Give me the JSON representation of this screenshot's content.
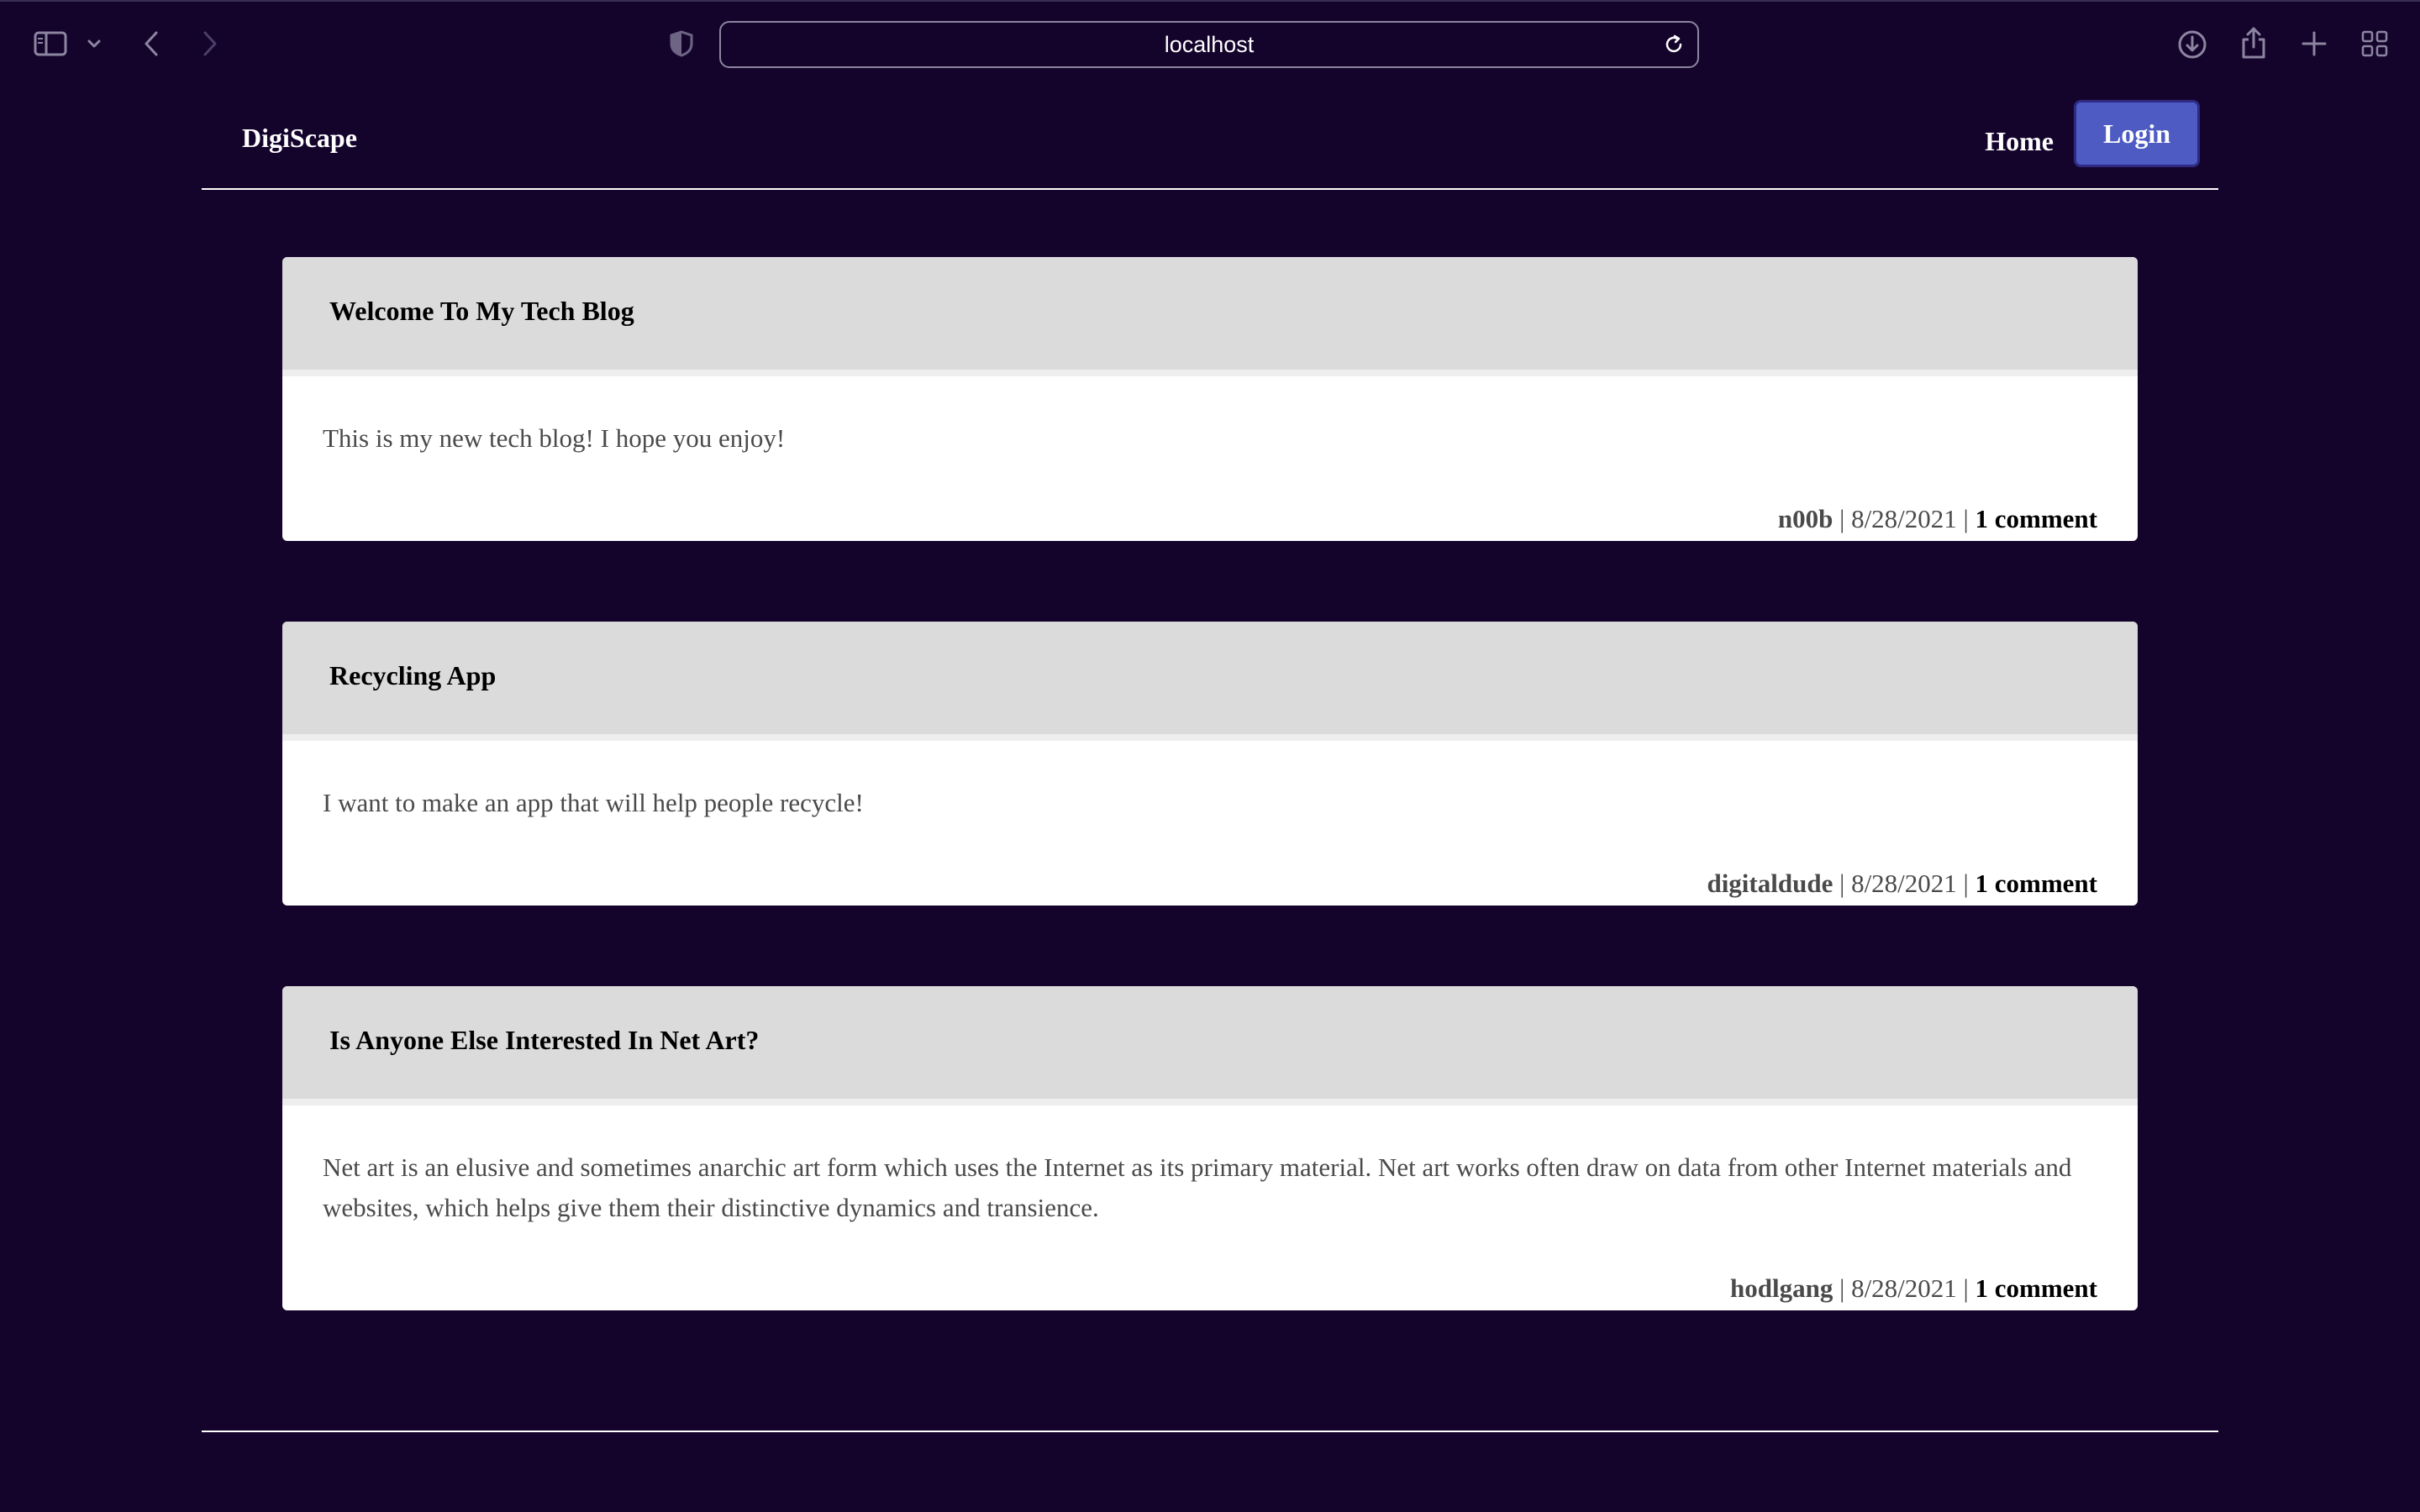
{
  "browser": {
    "url": "localhost"
  },
  "header": {
    "brand": "DigiScape",
    "nav_home": "Home",
    "nav_login": "Login"
  },
  "posts": [
    {
      "title": "Welcome To My Tech Blog",
      "body": "This is my new tech blog! I hope you enjoy!",
      "author": "n00b",
      "date": "8/28/2021",
      "comments": "1 comment"
    },
    {
      "title": "Recycling App",
      "body": "I want to make an app that will help people recycle!",
      "author": "digitaldude",
      "date": "8/28/2021",
      "comments": "1 comment"
    },
    {
      "title": "Is Anyone Else Interested In Net Art?",
      "body": "Net art is an elusive and sometimes anarchic art form which uses the Internet as its primary material. Net art works often draw on data from other Internet materials and websites, which helps give them their distinctive dynamics and transience.",
      "author": "hodlgang",
      "date": "8/28/2021",
      "comments": "1 comment"
    }
  ],
  "meta_separator": "|",
  "colors": {
    "page_background": "#14042c",
    "card_header": "#dbdbdb",
    "login_button": "#4d5bc3"
  },
  "icons": [
    "sidebar-icon",
    "chevron-down-icon",
    "back-arrow-icon",
    "forward-arrow-icon",
    "shield-icon",
    "reload-icon",
    "download-icon",
    "share-icon",
    "new-tab-icon",
    "tab-overview-icon"
  ]
}
